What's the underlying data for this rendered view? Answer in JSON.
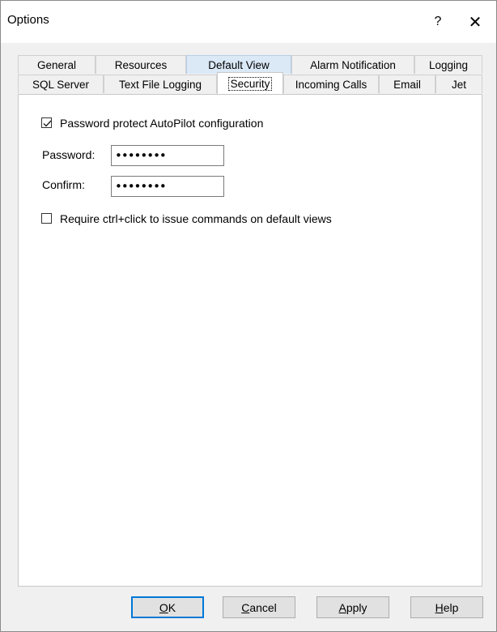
{
  "window": {
    "title": "Options",
    "help_glyph": "?",
    "close_glyph": "✕"
  },
  "tabs_back_row": [
    "General",
    "Resources",
    "Default View",
    "Alarm Notification",
    "Logging"
  ],
  "tabs_front_row": [
    "SQL Server",
    "Text File Logging",
    "Security",
    "Incoming Calls",
    "Email",
    "Jet"
  ],
  "security": {
    "protect_label": "Password protect AutoPilot configuration",
    "protect_checked": true,
    "password_label": "Password:",
    "password_value": "••••••••",
    "confirm_label": "Confirm:",
    "confirm_value": "••••••••",
    "ctrl_click_label": "Require ctrl+click to issue commands on default views",
    "ctrl_click_checked": false
  },
  "buttons": {
    "ok": {
      "accel": "O",
      "rest": "K"
    },
    "cancel": {
      "accel": "C",
      "rest": "ancel"
    },
    "apply": {
      "accel": "A",
      "rest": "pply"
    },
    "help": {
      "accel": "H",
      "rest": "elp"
    }
  },
  "colors": {
    "accent": "#0078d7",
    "tab_hover": "#dbe9f7"
  }
}
